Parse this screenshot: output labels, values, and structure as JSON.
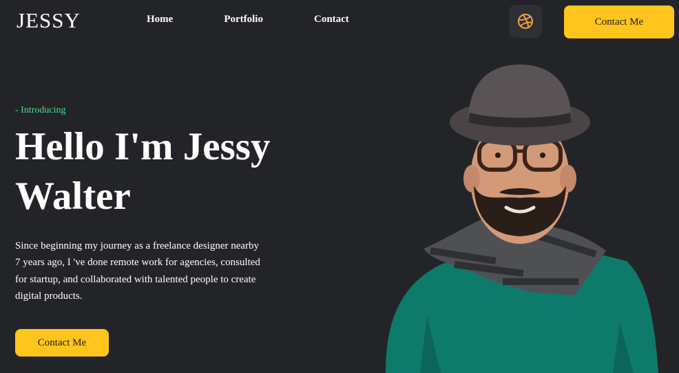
{
  "header": {
    "logo": "JESSY",
    "nav": [
      {
        "label": "Home"
      },
      {
        "label": "Portfolio"
      },
      {
        "label": "Contact"
      }
    ],
    "dribbble_icon": "dribbble-icon",
    "cta_label": "Contact Me"
  },
  "hero": {
    "intro": "- Introducing",
    "title": "Hello I'm Jessy Walter",
    "description": "Since beginning my journey as a freelance designer nearby 7 years ago, I 've done remote work for agencies, consulted for startup, and collaborated with talented people to create digital products.",
    "cta_label": "Contact Me"
  },
  "colors": {
    "background": "#232428",
    "accent": "#ffc51c",
    "intro_text": "#4ddc96",
    "icon": "#f5a13b"
  }
}
